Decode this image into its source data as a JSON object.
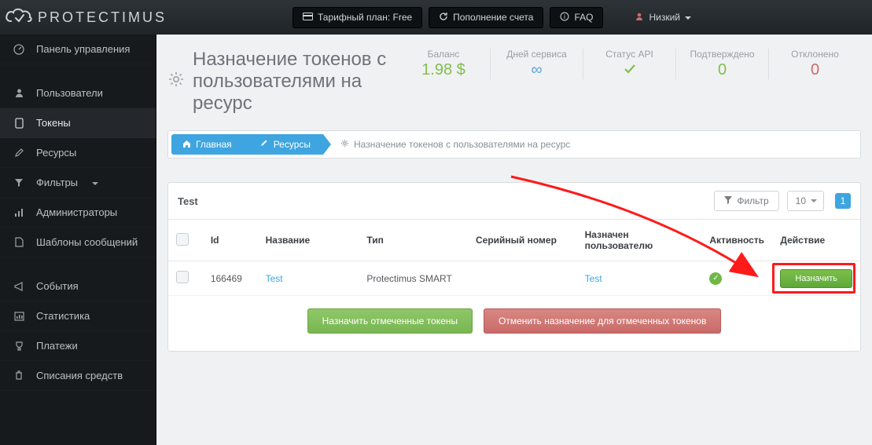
{
  "brand": "PROTECTIMUS",
  "topbar": {
    "plan_label": "Тарифный план: Free",
    "topup_label": "Пополнение счета",
    "faq_label": "FAQ",
    "user_label": "Низкий"
  },
  "sidebar": {
    "items": [
      {
        "label": "Панель управления"
      },
      {
        "label": "Пользователи"
      },
      {
        "label": "Токены"
      },
      {
        "label": "Ресурсы"
      },
      {
        "label": "Фильтры"
      },
      {
        "label": "Администраторы"
      },
      {
        "label": "Шаблоны сообщений"
      },
      {
        "label": "События"
      },
      {
        "label": "Статистика"
      },
      {
        "label": "Платежи"
      },
      {
        "label": "Списания средств"
      }
    ]
  },
  "page": {
    "title": "Назначение токенов с пользователями на ресурс"
  },
  "stats": {
    "balance_label": "Баланс",
    "balance_value": "1.98 $",
    "days_label": "Дней сервиса",
    "days_value": "∞",
    "api_label": "Статус API",
    "confirmed_label": "Подтверждено",
    "confirmed_value": "0",
    "rejected_label": "Отклонено",
    "rejected_value": "0"
  },
  "breadcrumb": {
    "home": "Главная",
    "resources": "Ресурсы",
    "last": "Назначение токенов с пользователями на ресурс"
  },
  "panel": {
    "title": "Test",
    "filter_label": "Фильтр",
    "page_size": "10",
    "page_number": "1",
    "columns": {
      "id": "Id",
      "name": "Название",
      "type": "Тип",
      "serial": "Серийный номер",
      "assigned": "Назначен пользователю",
      "active": "Активность",
      "action": "Действие"
    },
    "row": {
      "id": "166469",
      "name": "Test",
      "type": "Protectimus SMART",
      "serial": "",
      "assigned": "Test",
      "action_label": "Назначить"
    },
    "footer": {
      "assign_checked": "Назначить отмеченные токены",
      "unassign_checked": "Отменить назначение для отмеченных токенов"
    }
  }
}
